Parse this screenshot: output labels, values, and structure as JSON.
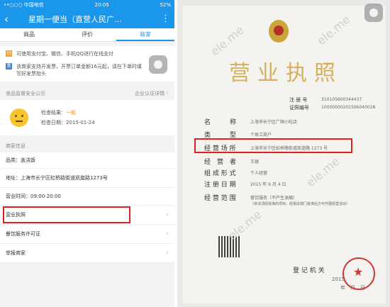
{
  "status_bar": {
    "carrier": "••○○○ 中国电信",
    "wifi": "WiFi",
    "time": "20:05",
    "battery": "52%"
  },
  "app_bar": {
    "back_icon": "back-arrow",
    "title": "星期一便当（直营人民广…",
    "more_icon": "more-dots"
  },
  "tabs": [
    {
      "label": "商品"
    },
    {
      "label": "评价"
    },
    {
      "label": "商家",
      "active": true
    }
  ],
  "notices": [
    {
      "badge": "付",
      "badge_color": "#f4a23b",
      "text": "可使用支付宝、微信、手机QQ进行在线支付"
    },
    {
      "badge": "票",
      "badge_color": "#4a7fd6",
      "text": "该商家支持开发票，开票订单金额16元起，请在下单时填写好发票抬头"
    }
  ],
  "food_safety": {
    "title": "食品监督安全公示",
    "link": "企业认证详情",
    "result_label": "检查结果：",
    "result_value": "一般",
    "date_label": "检查日期：",
    "date_value": "2015-01-24"
  },
  "merchant": {
    "section_title": "商家信息",
    "category": "品类：盖浇饭",
    "address": "地址：上海市长宁区虹桥路街道凯旋路1273号",
    "hours": "营业时间：09:00-20:00",
    "links": [
      "营业执照",
      "餐饮服务许可证",
      "举报商家"
    ]
  },
  "license": {
    "title": "营业执照",
    "reg_no_label": "注 册 号",
    "reg_no_value": "310105600344437",
    "cert_no_label": "证照编号",
    "cert_no_value": "10000000201506040028",
    "fields": [
      {
        "label": "名　　　称",
        "value": "上海市长宁区广顺小吃店"
      },
      {
        "label": "类　　　型",
        "value": "个体工商户"
      },
      {
        "label": "经 营 场 所",
        "value": "上海市长宁区虹桥路街道凯旋路 1273 号"
      },
      {
        "label": "经　营　者",
        "value": "王银"
      },
      {
        "label": "组 成 形 式",
        "value": "个人经营"
      },
      {
        "label": "注 册 日 期",
        "value": "2015 年 6 月 4 日"
      },
      {
        "label": "经 营 范 围",
        "value": "餐饮服务（不产生油烟）"
      }
    ],
    "scope_detail": "（依法须经批准的项目，经相关部门批准后方可开展经营活动）",
    "authority": "登 记 机 关",
    "year": "2015",
    "month_day": "年　月　日",
    "watermark": "ele.me"
  }
}
